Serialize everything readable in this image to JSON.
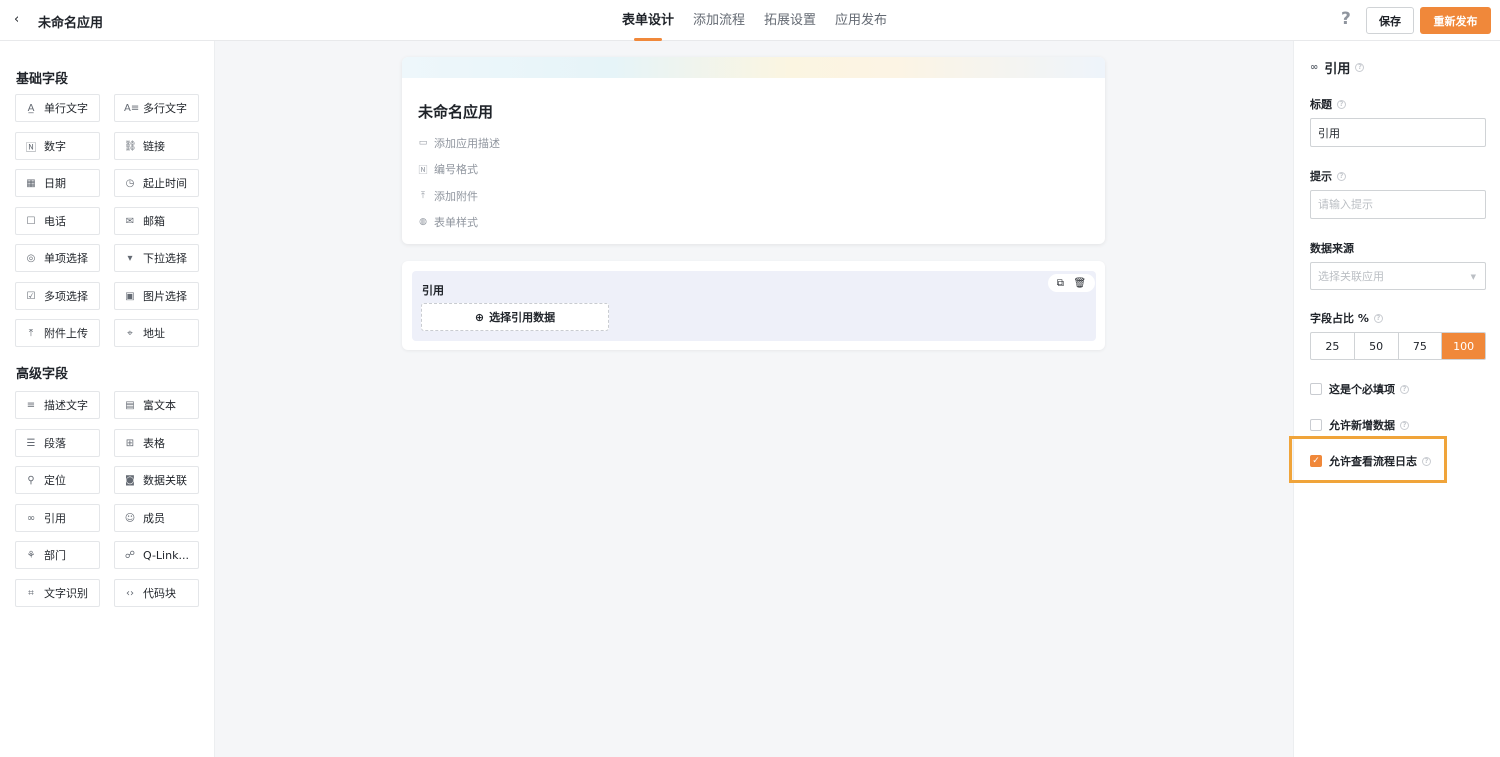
{
  "header": {
    "back_icon": "‹",
    "app_title": "未命名应用",
    "tabs": [
      "表单设计",
      "添加流程",
      "拓展设置",
      "应用发布"
    ],
    "help_icon": "?",
    "save_label": "保存",
    "publish_label": "重新发布"
  },
  "left": {
    "basic_title": "基础字段",
    "advanced_title": "高级字段",
    "basic_fields": [
      {
        "icon": "A̲",
        "label": "单行文字"
      },
      {
        "icon": "A≡",
        "label": "多行文字"
      },
      {
        "icon": "🄽",
        "label": "数字"
      },
      {
        "icon": "⛓",
        "label": "链接"
      },
      {
        "icon": "▦",
        "label": "日期"
      },
      {
        "icon": "◷",
        "label": "起止时间"
      },
      {
        "icon": "☐",
        "label": "电话"
      },
      {
        "icon": "✉",
        "label": "邮箱"
      },
      {
        "icon": "◎",
        "label": "单项选择"
      },
      {
        "icon": "▾",
        "label": "下拉选择"
      },
      {
        "icon": "☑",
        "label": "多项选择"
      },
      {
        "icon": "▣",
        "label": "图片选择"
      },
      {
        "icon": "⤒",
        "label": "附件上传"
      },
      {
        "icon": "⌖",
        "label": "地址"
      }
    ],
    "advanced_fields": [
      {
        "icon": "≡",
        "label": "描述文字"
      },
      {
        "icon": "▤",
        "label": "富文本"
      },
      {
        "icon": "☰",
        "label": "段落"
      },
      {
        "icon": "⊞",
        "label": "表格"
      },
      {
        "icon": "⚲",
        "label": "定位"
      },
      {
        "icon": "◙",
        "label": "数据关联"
      },
      {
        "icon": "∞",
        "label": "引用"
      },
      {
        "icon": "☺",
        "label": "成员"
      },
      {
        "icon": "⚘",
        "label": "部门"
      },
      {
        "icon": "☍",
        "label": "Q-Link..."
      },
      {
        "icon": "⌗",
        "label": "文字识别"
      },
      {
        "icon": "‹›",
        "label": "代码块"
      }
    ]
  },
  "canvas": {
    "form_title": "未命名应用",
    "meta_items": [
      {
        "icon": "▭",
        "label": "添加应用描述"
      },
      {
        "icon": "🄽",
        "label": "编号格式"
      },
      {
        "icon": "⤒",
        "label": "添加附件"
      },
      {
        "icon": "◍",
        "label": "表单样式"
      }
    ],
    "ref_label": "引用",
    "ref_button_icon": "⊕",
    "ref_button_label": "选择引用数据",
    "copy_icon": "⧉",
    "delete_icon": "🗑"
  },
  "right": {
    "head_icon": "∞",
    "head_title": "引用",
    "q_icon": "?",
    "title_label": "标题",
    "title_value": "引用",
    "hint_label": "提示",
    "hint_placeholder": "请输入提示",
    "source_label": "数据来源",
    "source_placeholder": "选择关联应用",
    "dropdown_arrow": "▼",
    "ratio_label": "字段占比 %",
    "ratio_options": [
      "25",
      "50",
      "75",
      "100"
    ],
    "selected_ratio": "100",
    "checkboxes": [
      {
        "label": "这是个必填项",
        "checked": false
      },
      {
        "label": "允许新增数据",
        "checked": false
      },
      {
        "label": "允许查看流程日志",
        "checked": true
      }
    ],
    "check_mark": "✓"
  },
  "colors": {
    "accent": "#f0883a",
    "highlight": "#f0a43a"
  }
}
